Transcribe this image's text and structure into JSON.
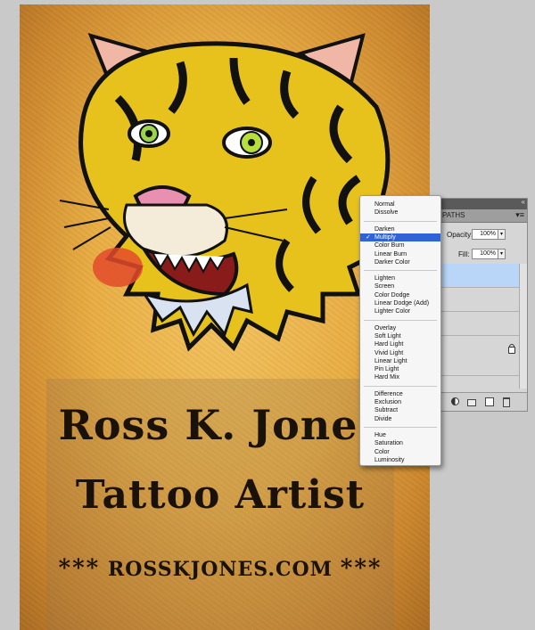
{
  "poster": {
    "name": "Ross K. Jones",
    "title": "Tattoo Artist",
    "stars_left": "***",
    "website": "ROSSKJONES.COM",
    "stars_right": "***"
  },
  "layers_panel": {
    "collapse_glyph": "«",
    "tab_label": "PATHS",
    "menu_glyph": "▾≡",
    "opacity_label": "Opacity:",
    "opacity_value": "100%",
    "fill_label": "Fill:",
    "fill_value": "100%",
    "drop_glyph": "▾"
  },
  "blend_menu": {
    "check_glyph": "✓",
    "selected": "Multiply",
    "groups": [
      [
        "Normal",
        "Dissolve"
      ],
      [
        "Darken",
        "Multiply",
        "Color Burn",
        "Linear Burn",
        "Darker Color"
      ],
      [
        "Lighten",
        "Screen",
        "Color Dodge",
        "Linear Dodge (Add)",
        "Lighter Color"
      ],
      [
        "Overlay",
        "Soft Light",
        "Hard Light",
        "Vivid Light",
        "Linear Light",
        "Pin Light",
        "Hard Mix"
      ],
      [
        "Difference",
        "Exclusion",
        "Subtract",
        "Divide"
      ],
      [
        "Hue",
        "Saturation",
        "Color",
        "Luminosity"
      ]
    ]
  },
  "colors": {
    "menu_highlight": "#2f63d6",
    "selected_layer": "#b9d5f7",
    "poster_base": "#e8ad44",
    "tiger_yellow": "#e8c21c"
  },
  "icons": [
    "lock-icon",
    "adjustment-layer-icon",
    "folder-icon",
    "new-layer-icon",
    "trash-icon",
    "tiger-illustration"
  ]
}
